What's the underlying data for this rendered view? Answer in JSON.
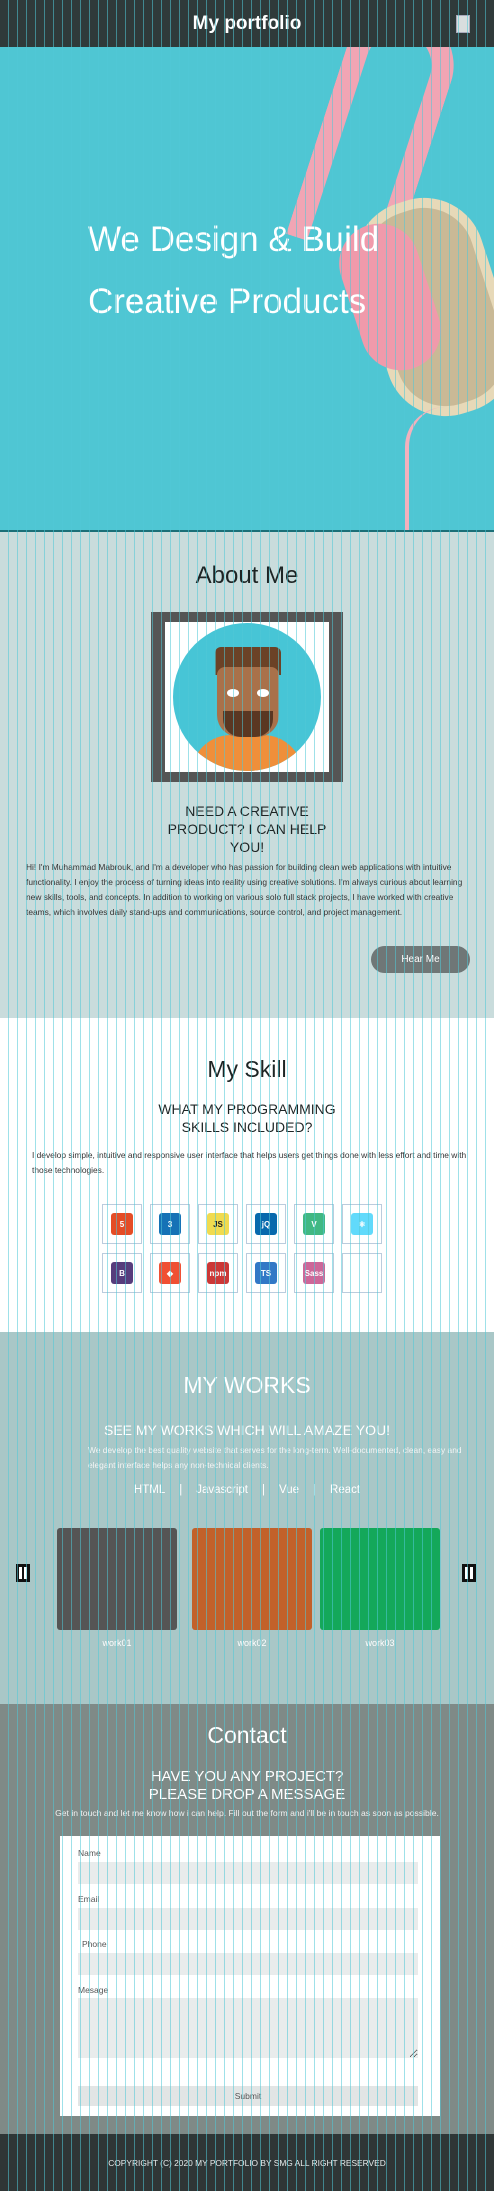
{
  "nav": {
    "title": "My portfolio",
    "menu_icon": "menu-icon"
  },
  "hero": {
    "title": "We Design & Build Creative Products"
  },
  "about": {
    "title": "About Me",
    "subtitle": "NEED A CREATIVE PRODUCT? I CAN HELP YOU!",
    "text": "Hi! I'm Muhammad Mabrouk, and I'm a developer who has passion for building clean web applications with intuitive functionality. I enjoy the process of turning ideas into reality using creative solutions. I'm always curious about learning new skills, tools, and concepts. In addition to working on various solo full stack projects, I have worked with creative teams, which involves daily stand-ups and communications, source control, and project management.",
    "button": "Hear Me"
  },
  "skills": {
    "title": "My Skill",
    "subtitle": "WHAT MY PROGRAMMING SKILLS INCLUDED?",
    "text": "I develop simple, intuitive and responsive user interface that helps users get things done with less effort and time with those technologies.",
    "items": [
      {
        "name": "HTML5",
        "label": "5",
        "icon": "html5-icon",
        "color": "#e44d26"
      },
      {
        "name": "CSS3",
        "label": "3",
        "icon": "css3-icon",
        "color": "#1572b6"
      },
      {
        "name": "JavaScript",
        "label": "JS",
        "icon": "javascript-icon",
        "color": "#f0db4f"
      },
      {
        "name": "jQuery",
        "label": "jQ",
        "icon": "jquery-icon",
        "color": "#0769ad"
      },
      {
        "name": "Vue",
        "label": "V",
        "icon": "vue-icon",
        "color": "#41b883"
      },
      {
        "name": "React",
        "label": "⚛",
        "icon": "react-icon",
        "color": "#61dafb"
      },
      {
        "name": "Bootstrap",
        "label": "B",
        "icon": "bootstrap-icon",
        "color": "#563d7c"
      },
      {
        "name": "Git",
        "label": "◆",
        "icon": "git-icon",
        "color": "#f05033"
      },
      {
        "name": "npm",
        "label": "npm",
        "icon": "npm-icon",
        "color": "#cb3837"
      },
      {
        "name": "TypeScript",
        "label": "TS",
        "icon": "typescript-icon",
        "color": "#3178c6"
      },
      {
        "name": "Sass",
        "label": "Sass",
        "icon": "sass-icon",
        "color": "#cd6799"
      },
      {
        "name": "empty",
        "label": "",
        "icon": "empty-slot",
        "color": "#ffffff"
      }
    ]
  },
  "works": {
    "title": "MY WORKS",
    "subtitle": "SEE MY WORKS WHICH WILL AMAZE YOU!",
    "text": "We develop the best quality website that serves for the long-term. Well-documented, clean, easy and elegant interface helps any non-technical clients.",
    "filters": [
      "HTML",
      "Javascript",
      "Vue",
      "React"
    ],
    "cards": [
      {
        "label": "work01",
        "color": "#555555"
      },
      {
        "label": "work02",
        "color": "#c2612a"
      },
      {
        "label": "work03",
        "color": "#14a85a"
      }
    ]
  },
  "contact": {
    "title": "Contact",
    "subtitle": "HAVE YOU ANY PROJECT? PLEASE DROP A MESSAGE",
    "text": "Get in touch and let me know how i can help. Fill out the form and i'll be in touch as soon as possible.",
    "labels": {
      "name": "Name",
      "email": "Email",
      "phone": "Phone",
      "message": "Mesage"
    },
    "submit": "Submit"
  },
  "footer": {
    "text": "COPYRIGHT (C) 2020 MY PORTFOLIO BY SMG ALL RIGHT RESERVED"
  }
}
